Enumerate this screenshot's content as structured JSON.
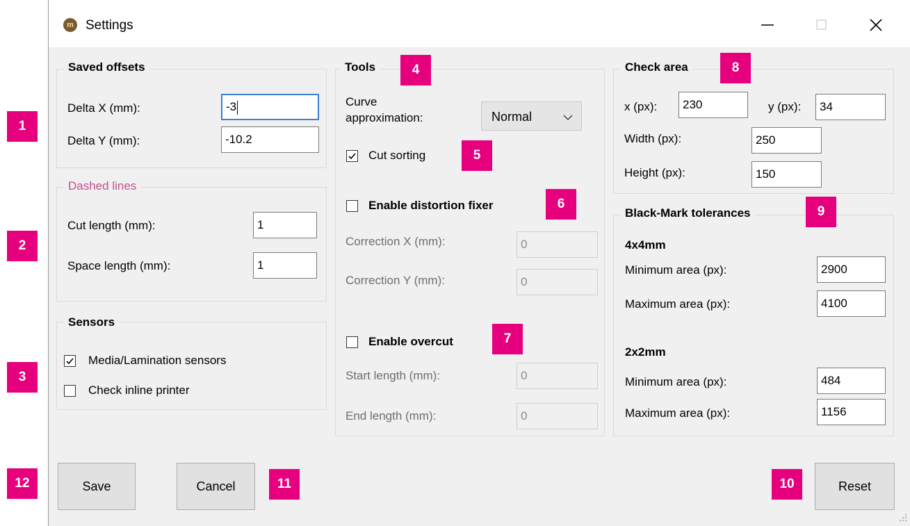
{
  "window": {
    "title": "Settings",
    "app_icon": "app-logo-icon"
  },
  "saved_offsets": {
    "title": "Saved offsets",
    "delta_x_label": "Delta X (mm):",
    "delta_x_value": "-3",
    "delta_y_label": "Delta Y (mm):",
    "delta_y_value": "-10.2"
  },
  "dashed_lines": {
    "title": "Dashed lines",
    "title_color": "#c0508f",
    "cut_length_label": "Cut length (mm):",
    "cut_length_value": "1",
    "space_length_label": "Space length (mm):",
    "space_length_value": "1"
  },
  "sensors": {
    "title": "Sensors",
    "media_label": "Media/Lamination sensors",
    "media_checked": true,
    "inline_label": "Check inline printer",
    "inline_checked": false
  },
  "tools": {
    "title": "Tools",
    "curve_label_1": "Curve",
    "curve_label_2": "approximation:",
    "curve_value": "Normal",
    "cut_sorting_label": "Cut sorting",
    "cut_sorting_checked": true,
    "distortion_label": "Enable distortion fixer",
    "distortion_checked": false,
    "correction_x_label": "Correction X (mm):",
    "correction_x_value": "0",
    "correction_y_label": "Correction Y (mm):",
    "correction_y_value": "0",
    "overcut_label": "Enable overcut",
    "overcut_checked": false,
    "start_length_label": "Start length (mm):",
    "start_length_value": "0",
    "end_length_label": "End length (mm):",
    "end_length_value": "0"
  },
  "check_area": {
    "title": "Check area",
    "x_label": "x (px):",
    "x_value": "230",
    "y_label": "y (px):",
    "y_value": "34",
    "width_label": "Width (px):",
    "width_value": "250",
    "height_label": "Height (px):",
    "height_value": "150"
  },
  "black_mark": {
    "title": "Black-Mark tolerances",
    "s4_title": "4x4mm",
    "s4_min_label": "Minimum area (px):",
    "s4_min_value": "2900",
    "s4_max_label": "Maximum area (px):",
    "s4_max_value": "4100",
    "s2_title": "2x2mm",
    "s2_min_label": "Minimum area (px):",
    "s2_min_value": "484",
    "s2_max_label": "Maximum area (px):",
    "s2_max_value": "1156"
  },
  "buttons": {
    "save": "Save",
    "cancel": "Cancel",
    "reset": "Reset"
  },
  "badges": [
    "1",
    "2",
    "3",
    "4",
    "5",
    "6",
    "7",
    "8",
    "9",
    "10",
    "11",
    "12"
  ],
  "accent_color": "#e6007e",
  "focus_color": "#3c7fd6"
}
